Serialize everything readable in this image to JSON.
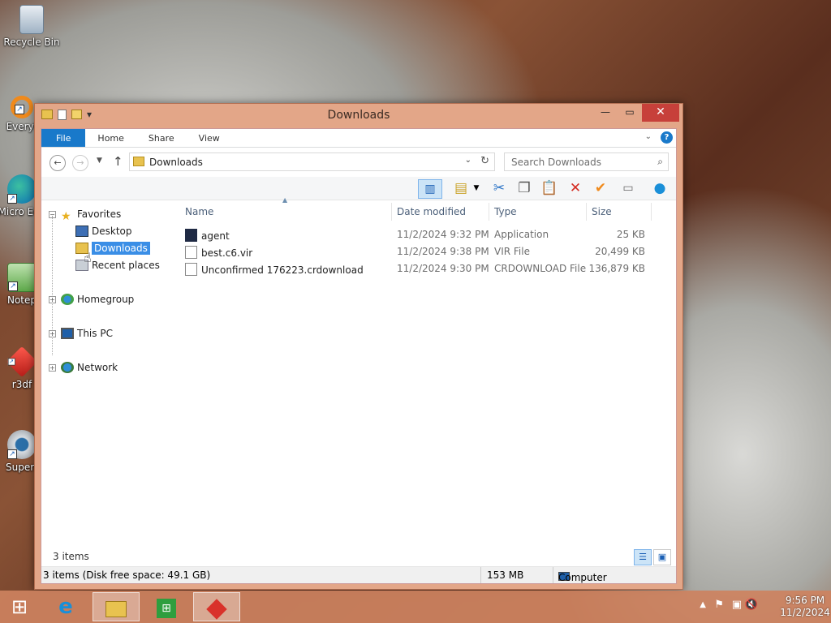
{
  "desktop": {
    "icons": [
      {
        "label": "Recycle Bin"
      },
      {
        "label": "Everyt"
      },
      {
        "label": "Micro Edg"
      },
      {
        "label": "Notep"
      },
      {
        "label": "r3df"
      },
      {
        "label": "Superr"
      }
    ]
  },
  "window": {
    "title": "Downloads",
    "ribbon_tabs": [
      "File",
      "Home",
      "Share",
      "View"
    ],
    "address": {
      "path": "Downloads",
      "search_placeholder": "Search Downloads"
    },
    "nav": {
      "favorites": "Favorites",
      "desktop": "Desktop",
      "downloads": "Downloads",
      "recent": "Recent places",
      "homegroup": "Homegroup",
      "thispc": "This PC",
      "network": "Network"
    },
    "columns": {
      "name": "Name",
      "date": "Date modified",
      "type": "Type",
      "size": "Size"
    },
    "files": [
      {
        "name": "agent",
        "date": "11/2/2024 9:32 PM",
        "type": "Application",
        "size": "25 KB"
      },
      {
        "name": "best.c6.vir",
        "date": "11/2/2024 9:38 PM",
        "type": "VIR File",
        "size": "20,499 KB"
      },
      {
        "name": "Unconfirmed 176223.crdownload",
        "date": "11/2/2024 9:30 PM",
        "type": "CRDOWNLOAD File",
        "size": "136,879 KB"
      }
    ],
    "item_count": "3 items",
    "status": {
      "left": "3 items (Disk free space: 49.1 GB)",
      "size": "153 MB",
      "location": "Computer"
    }
  },
  "taskbar": {
    "time": "9:56 PM",
    "date": "11/2/2024"
  },
  "colors": {
    "accent": "#1979ca",
    "titlebar": "#e3a688",
    "close": "#c7403a"
  }
}
